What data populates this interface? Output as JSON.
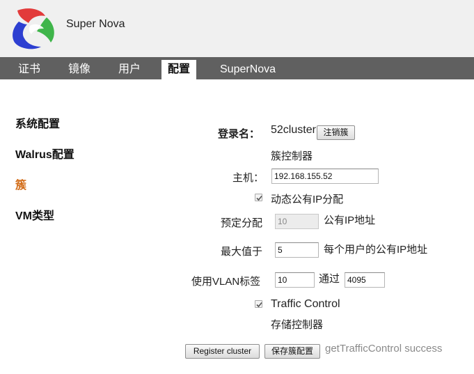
{
  "header": {
    "app_title": "Super Nova",
    "logo_icon": "supernova-logo-icon"
  },
  "nav": {
    "tabs": [
      {
        "label": "证书"
      },
      {
        "label": "镜像"
      },
      {
        "label": "用户"
      },
      {
        "label": "配置",
        "active": true
      },
      {
        "label": "SuperNova"
      }
    ]
  },
  "sidebar": {
    "items": [
      {
        "label": "系统配置"
      },
      {
        "label": "Walrus配置"
      },
      {
        "label": "簇",
        "active": true
      },
      {
        "label": "VM类型"
      }
    ]
  },
  "form": {
    "login_label": "登录名：",
    "login_value": "52cluster",
    "deregister_button": "注销簇",
    "cluster_controller_heading": "簇控制器",
    "host_label": "主机：",
    "host_value": "192.168.155.52",
    "dynamic_ip_checked": true,
    "dynamic_ip_label": "动态公有IP分配",
    "reserved_label": "预定分配",
    "reserved_value": "10",
    "reserved_suffix": "公有IP地址",
    "max_label": "最大值于",
    "max_value": "5",
    "max_suffix": "每个用户的公有IP地址",
    "vlan_label": "使用VLAN标签",
    "vlan_from": "10",
    "vlan_through": "通过",
    "vlan_to": "4095",
    "traffic_control_checked": true,
    "traffic_control_label": "Traffic Control",
    "storage_controller_heading": "存储控制器",
    "register_button": "Register cluster",
    "save_button": "保存簇配置",
    "status_message": "getTrafficControl success"
  }
}
